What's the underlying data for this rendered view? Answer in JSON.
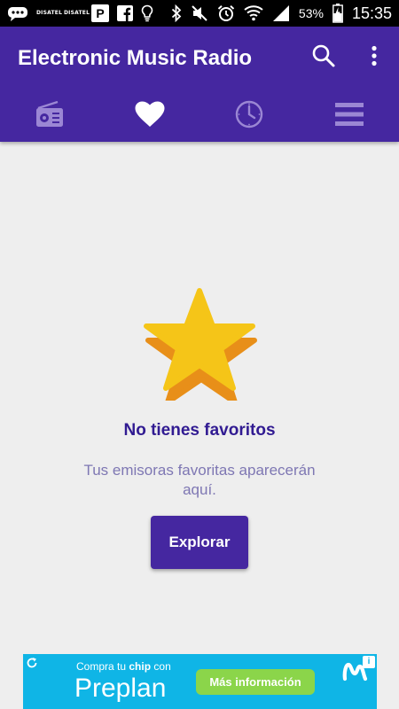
{
  "status_bar": {
    "carrier_1": "DISATEL",
    "carrier_2": "DISATEL",
    "p_label": "P",
    "battery_percent": "53%",
    "time": "15:35",
    "icons": [
      "chat-bubble-icon",
      "carrier-icon",
      "carrier-icon",
      "p-app-icon",
      "facebook-icon",
      "bulb-icon",
      "bluetooth-icon",
      "mute-icon",
      "alarm-icon",
      "wifi-icon",
      "signal-icon",
      "battery-icon"
    ]
  },
  "app_bar": {
    "title": "Electronic Music Radio",
    "color": "#4527a0",
    "actions": [
      "search-icon",
      "more-vert-icon"
    ],
    "tabs": [
      {
        "icon": "radio-icon",
        "active": false
      },
      {
        "icon": "heart-icon",
        "active": true
      },
      {
        "icon": "clock-icon",
        "active": false
      },
      {
        "icon": "menu-icon",
        "active": false
      }
    ]
  },
  "empty_state": {
    "icon": "star-icon",
    "title": "No tienes favoritos",
    "subtitle": "Tus emisoras favoritas aparecerán aquí.",
    "button_label": "Explorar"
  },
  "ad": {
    "line_prefix": "Compra tu",
    "line_bold": "chip",
    "line_suffix": "con",
    "brand": "Preplan",
    "cta": "Más información",
    "info_label": "i",
    "color": "#0fb5e6"
  }
}
